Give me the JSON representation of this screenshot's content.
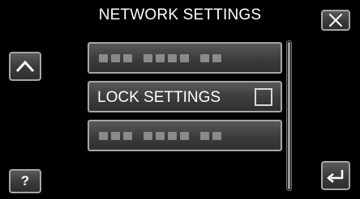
{
  "header": {
    "title": "NETWORK SETTINGS",
    "close_icon": "close-x-icon"
  },
  "nav": {
    "up_icon": "chevron-up-icon",
    "help_label": "?",
    "back_icon": "return-arrow-icon"
  },
  "menu": {
    "items": [
      {
        "label": "",
        "state": "disabled-obscured"
      },
      {
        "label": "LOCK SETTINGS",
        "checked": false
      },
      {
        "label": "",
        "state": "disabled-obscured"
      }
    ]
  },
  "colors": {
    "background": "#000000",
    "button_border": "#a6a6a6",
    "text": "#ffffff",
    "obscured_text": "#8a8a8a"
  }
}
